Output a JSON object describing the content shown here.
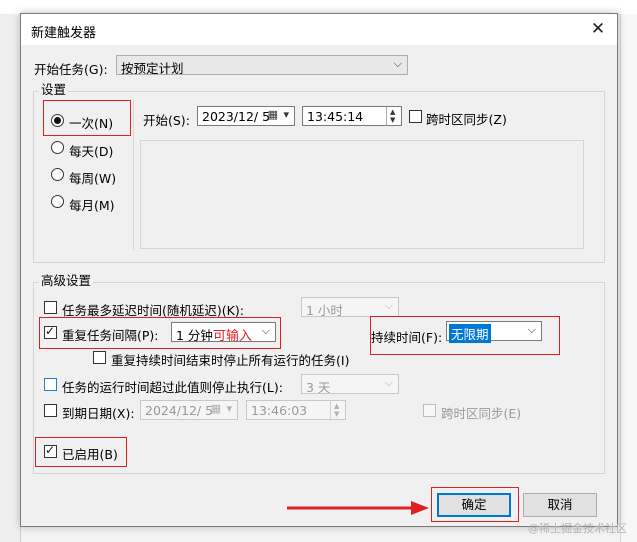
{
  "dialog": {
    "title": "新建触发器",
    "start_task_label": "开始任务(G):",
    "start_task_value": "按预定计划"
  },
  "settings": {
    "group_title": "设置",
    "radios": [
      {
        "label": "一次(N)",
        "checked": true
      },
      {
        "label": "每天(D)",
        "checked": false
      },
      {
        "label": "每周(W)",
        "checked": false
      },
      {
        "label": "每月(M)",
        "checked": false
      }
    ],
    "start_label": "开始(S):",
    "start_date": "2023/12/  5",
    "start_time": "13:45:14",
    "sync_timezone_label": "跨时区同步(Z)"
  },
  "advanced": {
    "group_title": "高级设置",
    "delay_label": "任务最多延迟时间(随机延迟)(K):",
    "delay_value": "1 小时",
    "repeat_label": "重复任务间隔(P):",
    "repeat_value": "1 分钟",
    "repeat_note": "可输入",
    "duration_label": "持续时间(F):",
    "duration_value": "无限期",
    "stop_all_label": "重复持续时间结束时停止所有运行的任务(I)",
    "stop_longer_label": "任务的运行时间超过此值则停止执行(L):",
    "stop_longer_value": "3 天",
    "expire_label": "到期日期(X):",
    "expire_date": "2024/12/  5",
    "expire_time": "13:46:03",
    "expire_sync_label": "跨时区同步(E)",
    "enabled_label": "已启用(B)"
  },
  "buttons": {
    "ok": "确定",
    "cancel": "取消"
  },
  "watermark": "@稀土掘金技术社区",
  "colors": {
    "annotation_red": "#e02020",
    "selection_blue": "#0078d7",
    "dialog_bg": "#f0f0f0"
  }
}
